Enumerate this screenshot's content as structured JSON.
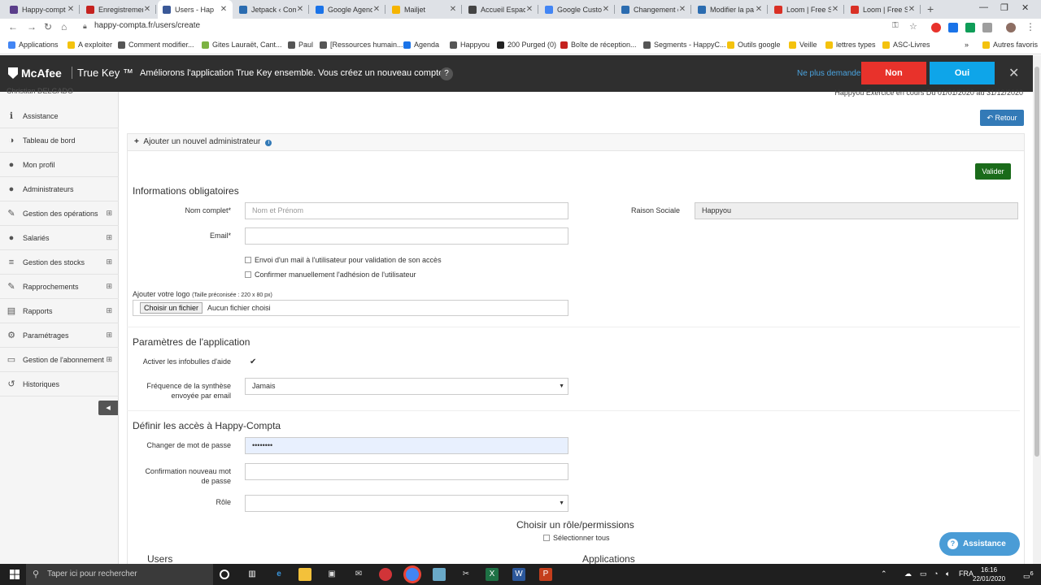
{
  "browser": {
    "tabs": [
      {
        "title": "Happy-compt",
        "color": "#5a3d8a",
        "active": false
      },
      {
        "title": "Enregistremen",
        "color": "#c5221f",
        "active": false
      },
      {
        "title": "Users - Hap",
        "color": "#3b5998",
        "active": true
      },
      {
        "title": "Jetpack ‹ Com",
        "color": "#2b6cb0",
        "active": false
      },
      {
        "title": "Google Agend",
        "color": "#1a73e8",
        "active": false
      },
      {
        "title": "Mailjet",
        "color": "#f5b400",
        "active": false
      },
      {
        "title": "Accueil Espac",
        "color": "#444444",
        "active": false
      },
      {
        "title": "Google Custo",
        "color": "#4285f4",
        "active": false
      },
      {
        "title": "Changement c",
        "color": "#2b6cb0",
        "active": false
      },
      {
        "title": "Modifier la pa",
        "color": "#2b6cb0",
        "active": false
      },
      {
        "title": "Loom | Free S",
        "color": "#d93025",
        "active": false
      },
      {
        "title": "Loom | Free S",
        "color": "#d93025",
        "active": false
      }
    ],
    "new_tab": "+",
    "url": "happy-compta.fr/users/create",
    "bookmarks": [
      {
        "label": "Applications",
        "color": "#4285f4"
      },
      {
        "label": "A exploiter",
        "color": "#f4c20d"
      },
      {
        "label": "Comment modifier...",
        "color": "#555555"
      },
      {
        "label": "Gites Lauraët, Cant...",
        "color": "#7cb342"
      },
      {
        "label": "Paul",
        "color": "#555555"
      },
      {
        "label": "[Ressources humain...",
        "color": "#555555"
      },
      {
        "label": "Agenda",
        "color": "#1a73e8"
      },
      {
        "label": "Happyou",
        "color": "#555555"
      },
      {
        "label": "200 Purged (0)",
        "color": "#222222"
      },
      {
        "label": "Boîte de réception...",
        "color": "#c5221f"
      },
      {
        "label": "Segments - HappyC...",
        "color": "#555555"
      },
      {
        "label": "Outils google",
        "color": "#f4c20d"
      },
      {
        "label": "Veille",
        "color": "#f4c20d"
      },
      {
        "label": "lettres types",
        "color": "#f4c20d"
      },
      {
        "label": "ASC-Livres",
        "color": "#f4c20d"
      }
    ],
    "more_bookmarks": "»",
    "other_favorites": "Autres favoris"
  },
  "mcafee": {
    "brand": "McAfee",
    "product": "True Key ™",
    "message": "Améliorons l'application True Key ensemble. Vous créez un nouveau compte ?",
    "help": "?",
    "never_ask": "Ne plus demander",
    "no": "Non",
    "yes": "Oui",
    "close": "✕"
  },
  "sidebar": {
    "user": "Christian DELGADO",
    "items": [
      {
        "label": "Assistance",
        "icon": "info-icon",
        "glyph": "ℹ",
        "expand": ""
      },
      {
        "label": "Tableau de bord",
        "icon": "dashboard-icon",
        "glyph": "◑",
        "expand": ""
      },
      {
        "label": "Mon profil",
        "icon": "user-icon",
        "glyph": "●",
        "expand": ""
      },
      {
        "label": "Administrateurs",
        "icon": "users-icon",
        "glyph": "●",
        "expand": ""
      },
      {
        "label": "Gestion des opérations",
        "icon": "edit-icon",
        "glyph": "✎",
        "expand": "⊞"
      },
      {
        "label": "Salariés",
        "icon": "users-icon",
        "glyph": "●",
        "expand": "⊞"
      },
      {
        "label": "Gestion des stocks",
        "icon": "database-icon",
        "glyph": "≡",
        "expand": "⊞"
      },
      {
        "label": "Rapprochements",
        "icon": "edit-icon",
        "glyph": "✎",
        "expand": "⊞"
      },
      {
        "label": "Rapports",
        "icon": "file-icon",
        "glyph": "▤",
        "expand": "⊞"
      },
      {
        "label": "Paramétrages",
        "icon": "gear-icon",
        "glyph": "⚙",
        "expand": "⊞"
      },
      {
        "label": "Gestion de l'abonnement",
        "icon": "card-icon",
        "glyph": "▭",
        "expand": "⊞"
      },
      {
        "label": "Historiques",
        "icon": "history-icon",
        "glyph": "↺",
        "expand": ""
      }
    ],
    "collapse": "◂"
  },
  "main": {
    "exercise_info": "Happyou Exercice en cours Du 01/01/2020 au 31/12/2020",
    "back_button": "Retour",
    "panel_title": "Ajouter un nouvel administrateur",
    "validate_button": "Valider",
    "required_section": "Informations obligatoires",
    "full_name_label": "Nom complet*",
    "full_name_placeholder": "Nom et Prénom",
    "email_label": "Email*",
    "email_value": "",
    "send_mail_label": "Envoi d'un mail à l'utilisateur pour validation de son accès",
    "confirm_manual_label": "Confirmer manuellement l'adhésion de l'utilisateur",
    "company_label": "Raison Sociale",
    "company_value": "Happyou",
    "logo_label": "Ajouter votre logo",
    "logo_hint": "(Taille préconisée : 220 x 80 px)",
    "file_button": "Choisir un fichier",
    "file_status": "Aucun fichier choisi",
    "app_section": "Paramètres de l'application",
    "tooltips_label": "Activer les infobulles d'aide",
    "tooltips_checked": "✔",
    "summary_label": "Fréquence de la synthèse envoyée par email",
    "summary_value": "Jamais",
    "access_section": "Définir les accès à Happy-Compta",
    "password_label": "Changer de mot de passe",
    "password_value": "••••••••",
    "confirm_password_label": "Confirmation nouveau mot de passe",
    "role_label": "Rôle",
    "role_value": "",
    "permissions_title": "Choisir un rôle/permissions",
    "select_all": "Sélectionner tous",
    "users_col": "Users",
    "apps_col": "Applications"
  },
  "assistance": {
    "label": "Assistance",
    "icon": "?"
  },
  "taskbar": {
    "search_placeholder": "Taper ici pour rechercher",
    "language": "FRA",
    "time": "16:16",
    "date": "22/01/2020",
    "notif_count": "6"
  }
}
